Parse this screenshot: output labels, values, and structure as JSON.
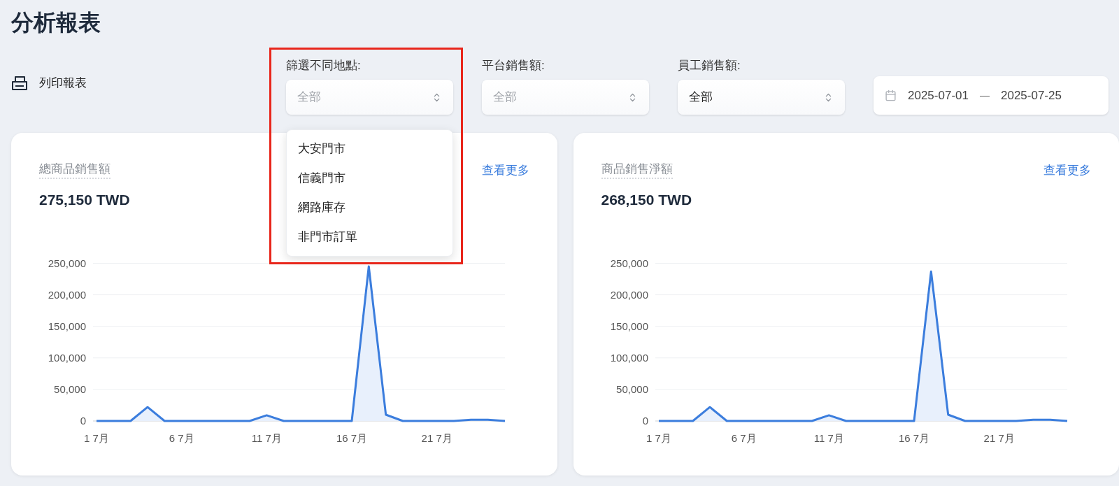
{
  "page_title": "分析報表",
  "print_button": {
    "label": "列印報表"
  },
  "filters": [
    {
      "kind": "select",
      "label": "篩選不同地點:",
      "placeholder": "全部",
      "highlighted": true,
      "options": [
        "大安門市",
        "信義門市",
        "網路庫存",
        "非門市訂單"
      ]
    },
    {
      "kind": "select",
      "label": "平台銷售額:",
      "placeholder": "全部"
    },
    {
      "kind": "select",
      "label": "員工銷售額:",
      "value": "全部"
    },
    {
      "kind": "date_range",
      "start": "2025-07-01",
      "separator": "—",
      "end": "2025-07-25"
    }
  ],
  "cards": [
    {
      "title": "總商品銷售額",
      "value": "275,150 TWD",
      "link": "查看更多",
      "chart_data": {
        "type": "area",
        "categories": [
          "1 7月",
          null,
          null,
          null,
          null,
          "6 7月",
          null,
          null,
          null,
          null,
          "11 7月",
          null,
          null,
          null,
          null,
          "16 7月",
          null,
          null,
          null,
          null,
          "21 7月",
          null,
          null,
          null,
          null
        ],
        "ylim": [
          0,
          250000
        ],
        "grid": true,
        "series": [
          {
            "color": "#3b7ddd",
            "values": [
              0,
              0,
              0,
              22000,
              0,
              0,
              0,
              0,
              0,
              0,
              9000,
              0,
              0,
              0,
              0,
              0,
              245000,
              10000,
              0,
              0,
              0,
              0,
              2000,
              2000,
              0
            ]
          }
        ],
        "yticks": [
          {
            "value": 0,
            "label": "0"
          },
          {
            "value": 50000,
            "label": "50,000"
          },
          {
            "value": 100000,
            "label": "100,000"
          },
          {
            "value": 150000,
            "label": "150,000"
          },
          {
            "value": 200000,
            "label": "200,000"
          },
          {
            "value": 250000,
            "label": "250,000"
          }
        ]
      }
    },
    {
      "title": "商品銷售淨額",
      "value": "268,150 TWD",
      "link": "查看更多",
      "chart_data": {
        "type": "area",
        "categories": [
          "1 7月",
          null,
          null,
          null,
          null,
          "6 7月",
          null,
          null,
          null,
          null,
          "11 7月",
          null,
          null,
          null,
          null,
          "16 7月",
          null,
          null,
          null,
          null,
          "21 7月",
          null,
          null,
          null,
          null
        ],
        "ylim": [
          0,
          250000
        ],
        "grid": true,
        "series": [
          {
            "color": "#3b7ddd",
            "values": [
              0,
              0,
              0,
              22000,
              0,
              0,
              0,
              0,
              0,
              0,
              9000,
              0,
              0,
              0,
              0,
              0,
              237000,
              10000,
              0,
              0,
              0,
              0,
              2000,
              2000,
              0
            ]
          }
        ],
        "yticks": [
          {
            "value": 0,
            "label": "0"
          },
          {
            "value": 50000,
            "label": "50,000"
          },
          {
            "value": 100000,
            "label": "100,000"
          },
          {
            "value": 150000,
            "label": "150,000"
          },
          {
            "value": 200000,
            "label": "200,000"
          },
          {
            "value": 250000,
            "label": "250,000"
          }
        ]
      }
    }
  ]
}
